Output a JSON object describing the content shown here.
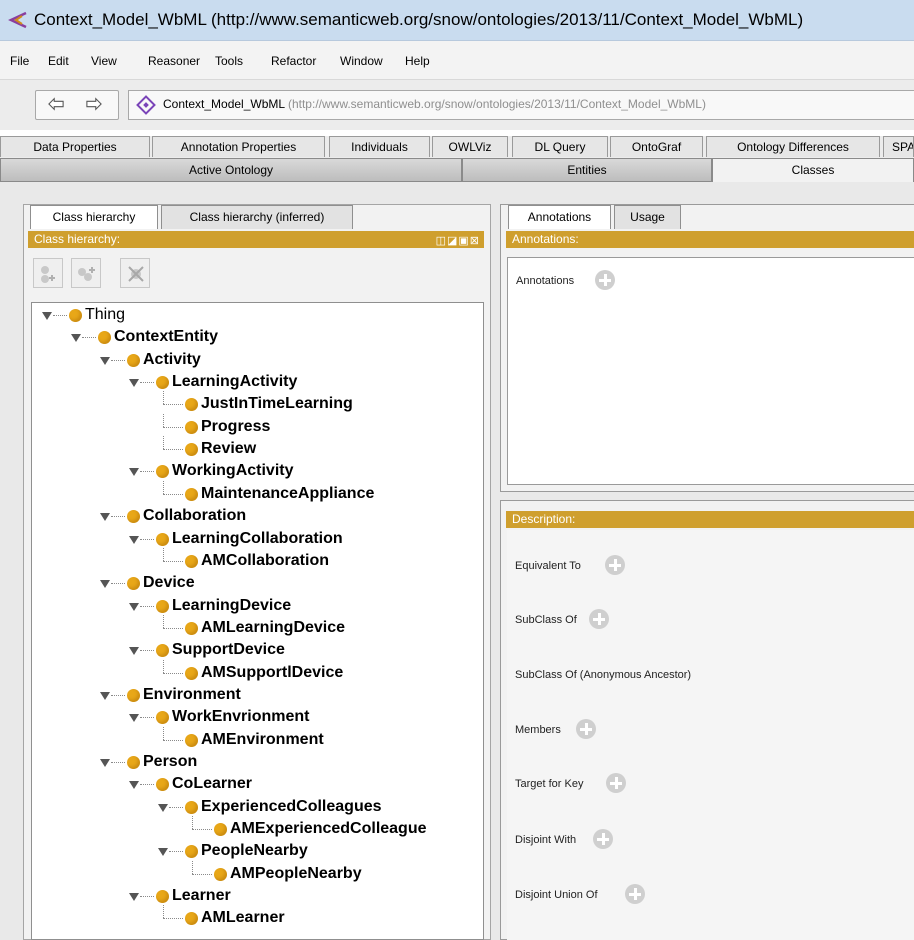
{
  "window": {
    "title": "Context_Model_WbML (http://www.semanticweb.org/snow/ontologies/2013/11/Context_Model_WbML)"
  },
  "menu": [
    "File",
    "Edit",
    "View",
    "Reasoner",
    "Tools",
    "Refactor",
    "Window",
    "Help"
  ],
  "address": {
    "name": "Context_Model_WbML",
    "url": "(http://www.semanticweb.org/snow/ontologies/2013/11/Context_Model_WbML)"
  },
  "tabs_top": [
    "Data Properties",
    "Annotation Properties",
    "Individuals",
    "OWLViz",
    "DL Query",
    "OntoGraf",
    "Ontology Differences",
    "SPA"
  ],
  "tabs_main": [
    "Active Ontology",
    "Entities",
    "Classes"
  ],
  "left": {
    "tabs": [
      "Class hierarchy",
      "Class hierarchy (inferred)"
    ],
    "header": "Class hierarchy:"
  },
  "tree": [
    {
      "label": "Thing",
      "depth": 0,
      "expanded": true,
      "bold": false
    },
    {
      "label": "ContextEntity",
      "depth": 1,
      "expanded": true,
      "bold": true
    },
    {
      "label": "Activity",
      "depth": 2,
      "expanded": true,
      "bold": true
    },
    {
      "label": "LearningActivity",
      "depth": 3,
      "expanded": true,
      "bold": true
    },
    {
      "label": "JustInTimeLearning",
      "depth": 4,
      "expanded": false,
      "bold": true
    },
    {
      "label": "Progress",
      "depth": 4,
      "expanded": false,
      "bold": true
    },
    {
      "label": "Review",
      "depth": 4,
      "expanded": false,
      "bold": true
    },
    {
      "label": "WorkingActivity",
      "depth": 3,
      "expanded": true,
      "bold": true
    },
    {
      "label": "MaintenanceAppliance",
      "depth": 4,
      "expanded": false,
      "bold": true
    },
    {
      "label": "Collaboration",
      "depth": 2,
      "expanded": true,
      "bold": true
    },
    {
      "label": "LearningCollaboration",
      "depth": 3,
      "expanded": true,
      "bold": true
    },
    {
      "label": "AMCollaboration",
      "depth": 4,
      "expanded": false,
      "bold": true
    },
    {
      "label": "Device",
      "depth": 2,
      "expanded": true,
      "bold": true
    },
    {
      "label": "LearningDevice",
      "depth": 3,
      "expanded": true,
      "bold": true
    },
    {
      "label": "AMLearningDevice",
      "depth": 4,
      "expanded": false,
      "bold": true
    },
    {
      "label": "SupportDevice",
      "depth": 3,
      "expanded": true,
      "bold": true
    },
    {
      "label": "AMSupportlDevice",
      "depth": 4,
      "expanded": false,
      "bold": true
    },
    {
      "label": "Environment",
      "depth": 2,
      "expanded": true,
      "bold": true
    },
    {
      "label": "WorkEnvrionment",
      "depth": 3,
      "expanded": true,
      "bold": true
    },
    {
      "label": "AMEnvironment",
      "depth": 4,
      "expanded": false,
      "bold": true
    },
    {
      "label": "Person",
      "depth": 2,
      "expanded": true,
      "bold": true
    },
    {
      "label": "CoLearner",
      "depth": 3,
      "expanded": true,
      "bold": true
    },
    {
      "label": "ExperiencedColleagues",
      "depth": 4,
      "expanded": true,
      "bold": true
    },
    {
      "label": "AMExperiencedColleague",
      "depth": 5,
      "expanded": false,
      "bold": true
    },
    {
      "label": "PeopleNearby",
      "depth": 4,
      "expanded": true,
      "bold": true
    },
    {
      "label": "AMPeopleNearby",
      "depth": 5,
      "expanded": false,
      "bold": true
    },
    {
      "label": "Learner",
      "depth": 3,
      "expanded": true,
      "bold": true
    },
    {
      "label": "AMLearner",
      "depth": 4,
      "expanded": false,
      "bold": true
    }
  ],
  "right": {
    "tabs": [
      "Annotations",
      "Usage"
    ],
    "annotations_header": "Annotations:",
    "annotations_label": "Annotations",
    "description_header": "Description:",
    "description": [
      {
        "label": "Equivalent To",
        "plus": true
      },
      {
        "label": "SubClass Of",
        "plus": true
      },
      {
        "label": "SubClass Of (Anonymous Ancestor)",
        "plus": false
      },
      {
        "label": "Members",
        "plus": true
      },
      {
        "label": "Target for Key",
        "plus": true
      },
      {
        "label": "Disjoint With",
        "plus": true
      },
      {
        "label": "Disjoint Union Of",
        "plus": true
      }
    ]
  },
  "icons": [
    "protege-app-icon",
    "back-arrow-icon",
    "forward-arrow-icon",
    "ontology-diamond-icon",
    "add-subclass-icon",
    "add-sibling-icon",
    "delete-class-icon",
    "add-annotation-icon"
  ]
}
